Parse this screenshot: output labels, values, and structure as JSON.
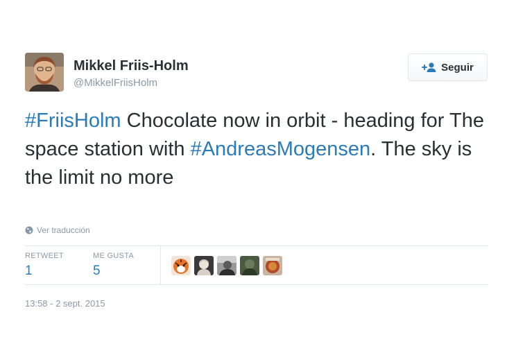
{
  "user": {
    "name": "Mikkel Friis-Holm",
    "handle": "@MikkelFriisHolm",
    "avatar_icon": "user-avatar-photo"
  },
  "follow_button": {
    "label": "Seguir",
    "icon": "add-user-icon"
  },
  "tweet": {
    "segments": [
      {
        "text": "#FriisHolm",
        "type": "hashtag"
      },
      {
        "text": " Chocolate now in orbit - heading for The space station with ",
        "type": "text"
      },
      {
        "text": "#AndreasMogensen",
        "type": "hashtag"
      },
      {
        "text": ". The sky is the limit no more",
        "type": "text"
      }
    ]
  },
  "translate": {
    "label": "Ver traducción",
    "icon": "globe-icon"
  },
  "stats": {
    "retweet_label": "RETWEET",
    "retweet_count": "1",
    "likes_label": "ME GUSTA",
    "likes_count": "5"
  },
  "likers": [
    "liker-avatar-1",
    "liker-avatar-2",
    "liker-avatar-3",
    "liker-avatar-4",
    "liker-avatar-5"
  ],
  "timestamp": "13:58 - 2 sept. 2015",
  "colors": {
    "link": "#2b7bb9",
    "text": "#292f33",
    "muted": "#8899a6",
    "border": "#e1e8ed"
  }
}
